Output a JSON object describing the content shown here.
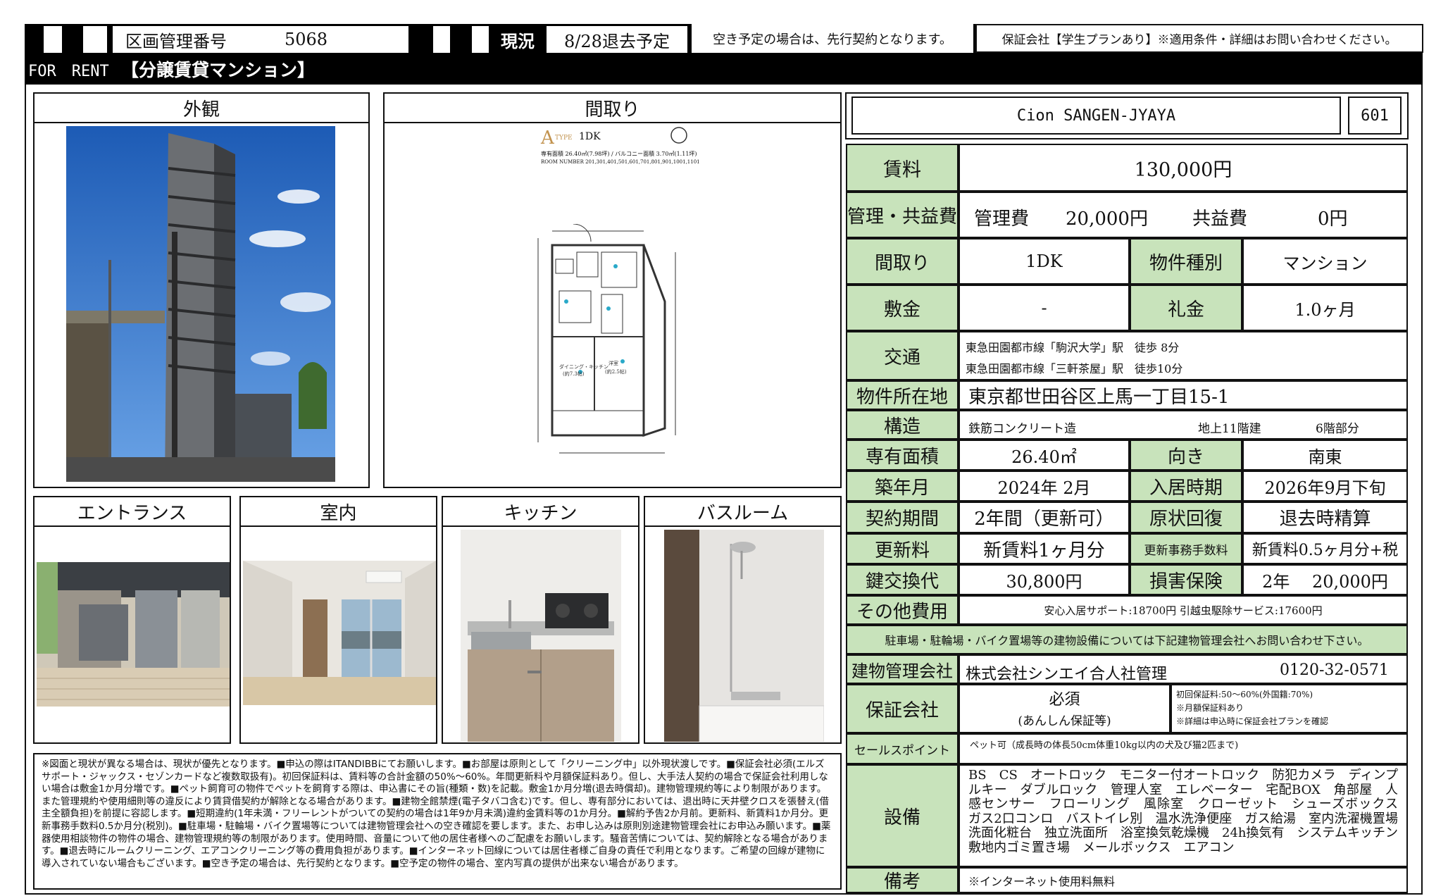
{
  "header": {
    "mgmt_label": "区画管理番号",
    "mgmt_number": "5068",
    "status_label": "現況",
    "status_value": "8/28退去予定",
    "vacancy_note": "空き予定の場合は、先行契約となります。",
    "guarantor_note": "保証会社【学生プランあり】※適用条件・詳細はお問い合わせください。",
    "for_rent": "FOR　RENT",
    "property_type_title": "【分譲賃貸マンション】"
  },
  "photos": {
    "exterior": "外観",
    "floorplan": "間取り",
    "entrance": "エントランス",
    "interior": "室内",
    "kitchen": "キッチン",
    "bathroom": "バスルーム"
  },
  "floorplan_meta": {
    "type_letter": "A",
    "type_word": "TYPE",
    "layout": "1DK",
    "area_line": "専有面積 26.40㎡(7.98坪) / バルコニー面積 3.70㎡(1.11坪)",
    "room_numbers": "ROOM NUMBER 201,301,401,501,601,701,801,901,1001,1101",
    "dk_label": "ダイニング・キッチン",
    "dk_size": "(約7.3帖)",
    "room_label": "洋室",
    "room_size": "(約2.5帖)"
  },
  "building": {
    "name": "Cion SANGEN-JYAYA",
    "room": "601"
  },
  "rows": {
    "rent_label": "賃料",
    "rent_value": "130,000円",
    "fees_label": "管理・共益費",
    "mgmt_fee_label": "管理費",
    "mgmt_fee_value": "20,000円",
    "common_fee_label": "共益費",
    "common_fee_value": "0円",
    "layout_label": "間取り",
    "layout_value": "1DK",
    "kind_label": "物件種別",
    "kind_value": "マンション",
    "deposit_label": "敷金",
    "deposit_value": "-",
    "keymoney_label": "礼金",
    "keymoney_value": "1.0ヶ月",
    "access_label": "交通",
    "access_line1": "東急田園都市線「駒沢大学」駅　徒歩 8分",
    "access_line2": "東急田園都市線「三軒茶屋」駅　徒歩10分",
    "address_label": "物件所在地",
    "address_value": "東京都世田谷区上馬一丁目15-1",
    "structure_label": "構造",
    "structure_value": "鉄筋コンクリート造",
    "floors_value": "地上11階建",
    "floor_part": "6階部分",
    "area_label": "専有面積",
    "area_value": "26.40㎡",
    "facing_label": "向き",
    "facing_value": "南東",
    "built_label": "築年月",
    "built_value": "2024年 2月",
    "movein_label": "入居時期",
    "movein_value": "2026年9月下旬",
    "term_label": "契約期間",
    "term_value": "2年間（更新可）",
    "restore_label": "原状回復",
    "restore_value": "退去時精算",
    "renew_label": "更新料",
    "renew_value": "新賃料1ヶ月分",
    "renewfee_label": "更新事務手数料",
    "renewfee_value": "新賃料0.5ヶ月分+税",
    "key_label": "鍵交換代",
    "key_value": "30,800円",
    "insurance_label": "損害保険",
    "insurance_value": "2年　 20,000円",
    "other_label": "その他費用",
    "other_value": "安心入居サポート:18700円 引越虫駆除サービス:17600円",
    "parking_note": "駐車場・駐輪場・バイク置場等の建物設備については下記建物管理会社へお問い合わせ下さい。",
    "mgmt_co_label": "建物管理会社",
    "mgmt_co_value": "株式会社シンエイ合人社管理",
    "mgmt_co_phone": "0120-32-0571",
    "guarantor_label": "保証会社",
    "guarantor_required": "必須",
    "guarantor_example": "(あんしん保証等)",
    "guarantor_detail1": "初回保証料:50～60%(外国籍:70%)",
    "guarantor_detail2": "※月額保証料あり",
    "guarantor_detail3": "※詳細は申込時に保証会社プランを確認",
    "sales_label": "セールスポイント",
    "sales_value": "ペット可（成長時の体長50cm体重10kg以内の犬及び猫2匹まで)",
    "equip_label": "設備",
    "equip_value": "BS　CS　オートロック　モニター付オートロック　防犯カメラ　ディンプルキー　ダブルロック　管理人室　エレベーター　宅配BOX　角部屋　人感センサー　フローリング　風除室　クローゼット　シューズボックス　ガス2口コンロ　バストイレ別　温水洗浄便座　ガス給湯　室内洗濯機置場　洗面化粧台　独立洗面所　浴室換気乾燥機　24h換気有　システムキッチン　敷地内ゴミ置き場　メールボックス　エアコン",
    "remarks_label": "備考",
    "remarks_value": "※インターネット使用料無料"
  },
  "notes": "※図面と現状が異なる場合は、現状が優先となります。■申込の際はITANDIBBにてお願いします。■お部屋は原則として「クリーニング中」以外現状渡しです。■保証会社必須(エルズサポート・ジャックス・セゾンカードなど複数取扱有)。初回保証料は、賃料等の合計金額の50%～60%。年間更新料や月額保証料あり。但し、大手法人契約の場合で保証会社利用しない場合は敷金1か月分増です。■ペット飼育可の物件でペットを飼育する際は、申込書にその旨(種類・数)を記載。敷金1か月分増(退去時償却)。建物管理規約等により制限があります。また管理規約や使用細則等の違反により賃貸借契約が解除となる場合があります。■建物全館禁煙(電子タバコ含む)です。但し、専有部分においては、退出時に天井壁クロスを張替え(借主全額負担)を前提に容認します。■短期違約(1年未満・フリーレントがついての契約の場合は1年9か月未満)違約金賃料等の1か月分。■解約予告2か月前。更新料、新賃料1か月分。更新事務手数料0.5か月分(税別)。■駐車場・駐輪場・バイク置場等については建物管理会社への空き確認を要します。また、お申し込みは原則別途建物管理会社にお申込み願います。■薬器使用相談物件の物件の場合、建物管理規約等の制限があります。使用時間、音量について他の居住者様へのご配慮をお願いします。騒音苦情については、契約解除となる場合があります。■退去時にルームクリーニング、エアコンクリーニング等の費用負担があります。■インターネット回線については居住者様ご自身の責任で利用となります。ご希望の回線が建物に導入されていない場合もございます。■空き予定の場合は、先行契約となります。■空予定の物件の場合、室内写真の提供が出来ない場合があります。",
  "colors": {
    "label_bg": "#c8e3bb",
    "header_bg": "#000000",
    "sky": "#2f6fc4"
  }
}
